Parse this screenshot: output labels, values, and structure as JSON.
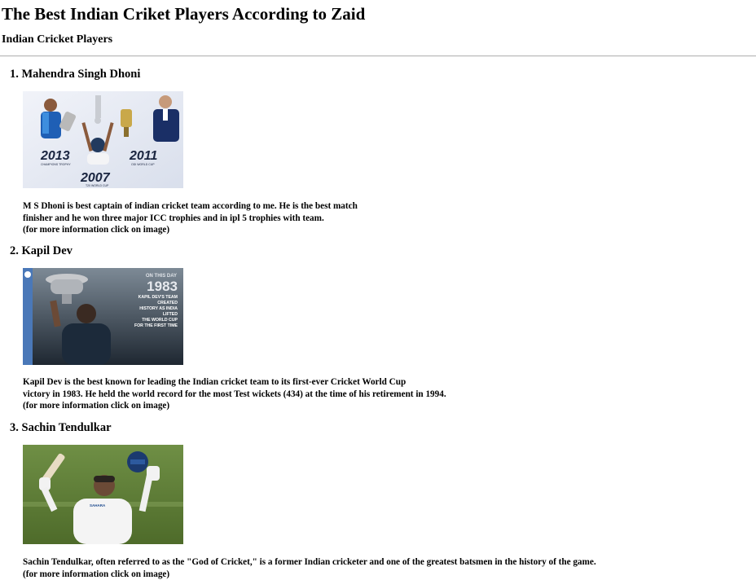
{
  "page": {
    "title": "The Best Indian Criket Players According to Zaid",
    "subtitle": "Indian Cricket Players"
  },
  "players": [
    {
      "heading": "1. Mahendra Singh Dhoni",
      "image_alt": "Mahendra Singh Dhoni",
      "image_texts": {
        "year_left": "2013",
        "caption_left": "CHAMPIONS TROPHY",
        "year_right": "2011",
        "caption_right": "ODI WORLD CUP",
        "year_bottom": "2007",
        "caption_bottom": "T20 WORLD CUP"
      },
      "desc_line1": "M S Dhoni is best captain of indian cricket team according to me. He is the best match",
      "desc_line2": "finisher and he won three major ICC trophies and in ipl 5 trophies with team.",
      "more_info": "(for more information click on image)"
    },
    {
      "heading": "2. Kapil Dev",
      "image_alt": "Kapil Dev",
      "image_texts": {
        "on_this_day": "ON THIS DAY",
        "year": "1983",
        "caption_lines": [
          "KAPIL DEV'S TEAM",
          "CREATED",
          "HISTORY AS INDIA",
          "LIFTED",
          "THE WORLD CUP",
          "FOR THE FIRST TIME"
        ]
      },
      "desc_line1": "Kapil Dev is the best known for leading the Indian cricket team to its first-ever Cricket World Cup",
      "desc_line2": "victory in 1983. He held the world record for the most Test wickets (434) at the time of his retirement in 1994.",
      "more_info": "(for more information click on image)"
    },
    {
      "heading": "3. Sachin Tendulkar",
      "image_alt": "Sachin Tendulkar",
      "image_texts": {
        "shirt_text": "SAHARA"
      },
      "desc_line1": "Sachin Tendulkar, often referred to as the \"God of Cricket,\" is a former Indian cricketer and one of the greatest batsmen in the history of the game.",
      "more_info": "(for more information click on image)"
    }
  ],
  "colors": {
    "divider": "#bdbdbd",
    "dhoni_bg": "#e4e8f2",
    "india_blue": "#1f5fb5",
    "kapil_bg": "#3a4654",
    "sachin_grass": "#5f7f35"
  }
}
